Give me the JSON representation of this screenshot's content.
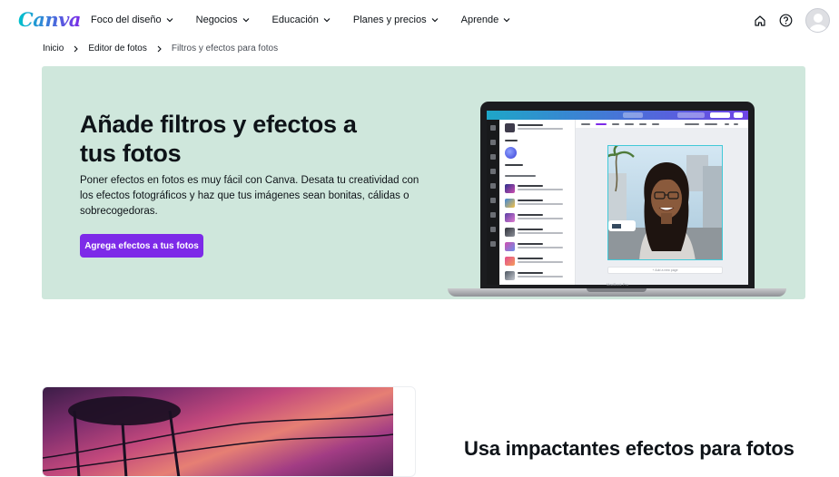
{
  "brand": {
    "logo_text": "Canva",
    "accent": "#7d2ae8",
    "hero_bg": "#cfe7dc"
  },
  "nav": {
    "items": [
      {
        "label": "Foco del diseño"
      },
      {
        "label": "Negocios"
      },
      {
        "label": "Educación"
      },
      {
        "label": "Planes y precios"
      },
      {
        "label": "Aprende"
      }
    ],
    "right_icons": [
      "home-icon",
      "help-icon",
      "avatar"
    ]
  },
  "breadcrumb": {
    "items": [
      {
        "label": "Inicio"
      },
      {
        "label": "Editor de fotos"
      },
      {
        "label": "Filtros y efectos para fotos"
      }
    ]
  },
  "hero": {
    "title": "Añade filtros y efectos a tus fotos",
    "description": "Poner efectos en fotos es muy fácil con Canva. Desata tu creatividad con los efectos fotográficos y haz que tus imágenes sean bonitas, cálidas o sobrecogedoras.",
    "cta_label": "Agrega efectos a tus fotos",
    "device_label": "MacBook Pro"
  },
  "section2": {
    "title": "Usa impactantes efectos para fotos"
  }
}
